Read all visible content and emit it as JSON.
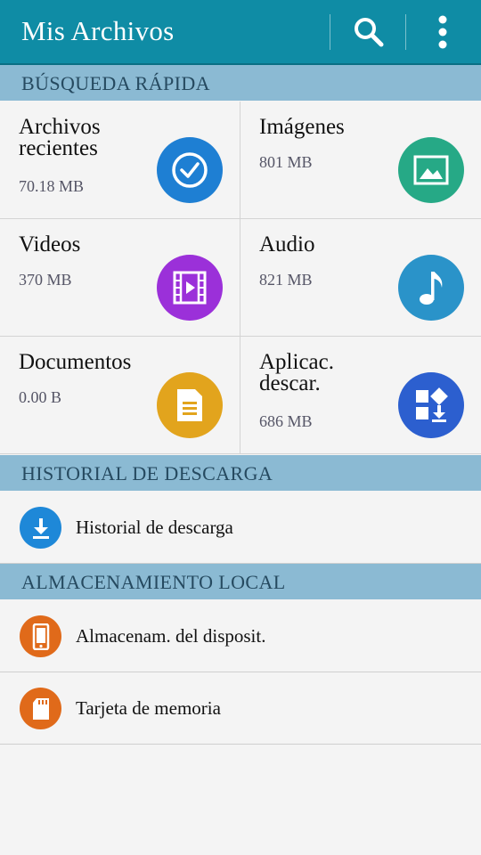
{
  "app": {
    "title": "Mis Archivos"
  },
  "colors": {
    "appbar": "#0f8ca5",
    "section_header": "#8bbad3",
    "recent": "#1e7fd3",
    "images": "#26a986",
    "videos": "#9b30d9",
    "audio": "#2a93c9",
    "documents": "#e2a41d",
    "apps": "#2c5fcf",
    "download": "#1e88d8",
    "storage": "#e06a1a"
  },
  "actions": {
    "search_icon": "search-icon",
    "menu_icon": "more-vert-icon"
  },
  "quick_search": {
    "header": "BÚSQUEDA RÁPIDA",
    "items": [
      {
        "name": "Archivos recientes",
        "size": "70.18 MB",
        "icon": "clock-check-icon"
      },
      {
        "name": "Imágenes",
        "size": "801 MB",
        "icon": "image-icon"
      },
      {
        "name": "Videos",
        "size": "370 MB",
        "icon": "film-icon"
      },
      {
        "name": "Audio",
        "size": "821 MB",
        "icon": "music-note-icon"
      },
      {
        "name": "Documentos",
        "size": "0.00 B",
        "icon": "document-icon"
      },
      {
        "name": "Aplicac. descar.",
        "size": "686 MB",
        "icon": "apps-download-icon"
      }
    ]
  },
  "download_history": {
    "header": "HISTORIAL DE DESCARGA",
    "items": [
      {
        "label": "Historial de descarga",
        "icon": "download-icon"
      }
    ]
  },
  "local_storage": {
    "header": "ALMACENAMIENTO LOCAL",
    "items": [
      {
        "label": "Almacenam. del disposit.",
        "icon": "phone-icon"
      },
      {
        "label": "Tarjeta de memoria",
        "icon": "sd-card-icon"
      }
    ]
  }
}
